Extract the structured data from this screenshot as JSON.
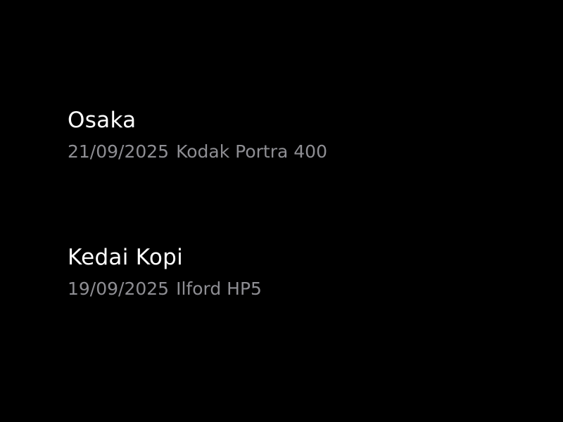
{
  "rolls": [
    {
      "title": "Osaka",
      "date": "21/09/2025",
      "film": "Kodak Portra 400"
    },
    {
      "title": "Kedai Kopi",
      "date": "19/09/2025",
      "film": "Ilford HP5"
    }
  ],
  "colors": {
    "background": "#000000",
    "title": "#ffffff",
    "meta": "#8e8e93"
  }
}
